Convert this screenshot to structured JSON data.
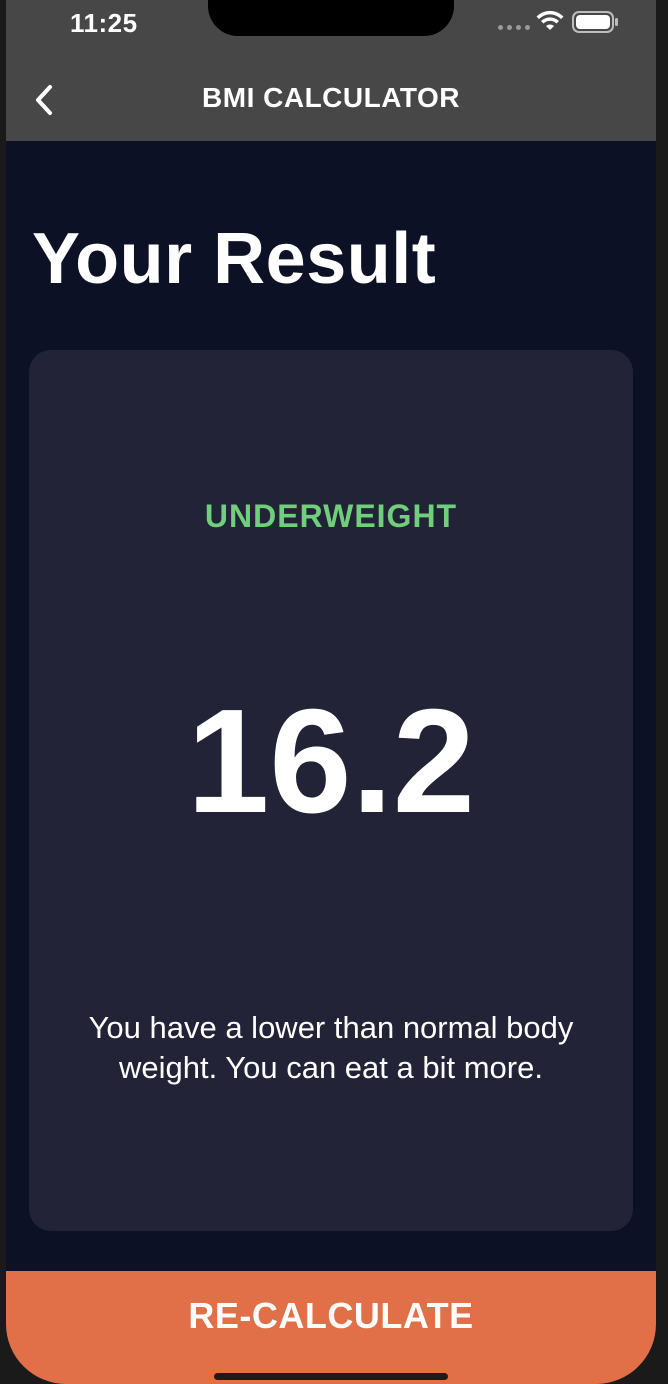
{
  "status_bar": {
    "time": "11:25"
  },
  "app_bar": {
    "title": "BMI CALCULATOR",
    "back_icon": "chevron-left-icon"
  },
  "page": {
    "title": "Your Result"
  },
  "result": {
    "status": "UNDERWEIGHT",
    "status_color": "#6fcf7a",
    "bmi": "16.2",
    "message": "You have a lower than normal body weight. You can eat a bit more."
  },
  "footer": {
    "button_label": "RE-CALCULATE",
    "button_color": "#e16f47"
  },
  "colors": {
    "background": "#0c1125",
    "card": "#222337",
    "app_bar": "#474747"
  }
}
